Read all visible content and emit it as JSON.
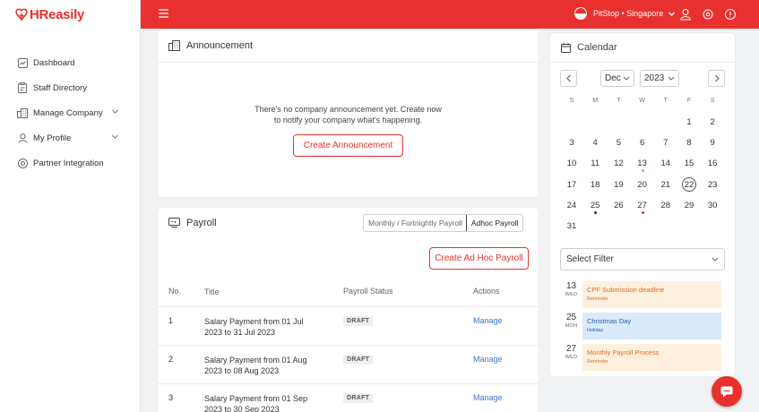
{
  "brand": {
    "name_h": "H",
    "name_rest": "Reasily",
    "accent": "#e8312e"
  },
  "sidebar": {
    "items": [
      {
        "label": "Dashboard",
        "icon": "dashboard-icon",
        "expandable": false
      },
      {
        "label": "Staff Directory",
        "icon": "clipboard-icon",
        "expandable": false
      },
      {
        "label": "Manage Company",
        "icon": "building-icon",
        "expandable": true
      },
      {
        "label": "My Profile",
        "icon": "user-icon",
        "expandable": true
      },
      {
        "label": "Partner Integration",
        "icon": "integration-icon",
        "expandable": false
      }
    ]
  },
  "topbar": {
    "company": "PitStop • Singapore",
    "icons": [
      "profile-icon",
      "settings-icon",
      "help-icon"
    ]
  },
  "announcement": {
    "title": "Announcement",
    "empty_line1": "There's no company announcement yet. Create now",
    "empty_line2": "to notify your company what's happening.",
    "button": "Create Announcement"
  },
  "payroll": {
    "title": "Payroll",
    "tabs": [
      "Monthly / Fortnightly Payroll",
      "Adhoc Payroll"
    ],
    "active_tab": "Adhoc Payroll",
    "button": "Create Ad Hoc Payroll",
    "columns": {
      "no": "No.",
      "title": "Title",
      "status": "Payroll Status",
      "actions": "Actions"
    },
    "rows": [
      {
        "no": "1",
        "title_line1": "Salary Payment from 01 Jul",
        "title_line2": "2023 to 31 Jul 2023",
        "status": "DRAFT",
        "action": "Manage"
      },
      {
        "no": "2",
        "title_line1": "Salary Payment from 01 Aug",
        "title_line2": "2023 to 08 Aug 2023",
        "status": "DRAFT",
        "action": "Manage"
      },
      {
        "no": "3",
        "title_line1": "Salary Payment from 01 Sep",
        "title_line2": "2023 to 30 Sep 2023",
        "status": "DRAFT",
        "action": "Manage"
      }
    ]
  },
  "calendar": {
    "title": "Calendar",
    "month": "Dec",
    "year": "2023",
    "weekdays": [
      "S",
      "M",
      "T",
      "W",
      "T",
      "F",
      "S"
    ],
    "first_weekday_index": 5,
    "days_in_month": 31,
    "today": 22,
    "marked_days": [
      {
        "day": 13,
        "color": "#f0a35e"
      },
      {
        "day": 25,
        "color": "#333333"
      },
      {
        "day": 27,
        "color": "#e8312e"
      }
    ],
    "filter_placeholder": "Select Filter",
    "events": [
      {
        "day": "13",
        "dow": "WED",
        "title": "CPF Submission deadline",
        "type": "Reminder",
        "bg": "#fdf1de",
        "fg": "#e06a2b"
      },
      {
        "day": "25",
        "dow": "MON",
        "title": "Christmas Day",
        "type": "Holiday",
        "bg": "#d9ebfb",
        "fg": "#2a5f9e"
      },
      {
        "day": "27",
        "dow": "WED",
        "title": "Monthly Payroll Process",
        "type": "Reminder",
        "bg": "#fdf1de",
        "fg": "#e06a2b"
      }
    ]
  }
}
